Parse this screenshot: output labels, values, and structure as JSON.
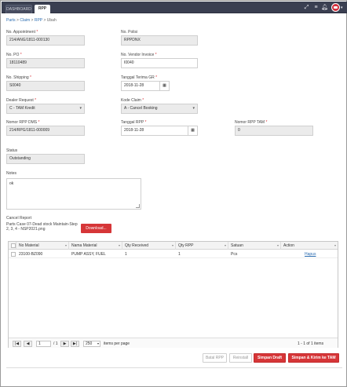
{
  "topbar": {
    "tabs": [
      "DASHBOARD",
      "RPP"
    ],
    "icons": [
      "expand-icon",
      "list-icon",
      "bell-icon",
      "user-avatar-icon"
    ]
  },
  "breadcrumb": {
    "items": [
      "Parts",
      "Claim",
      "RPP"
    ],
    "current": "Ubah"
  },
  "form": {
    "no_appointment": {
      "label": "No. Appointment",
      "value": "214/ANG/1811-000130"
    },
    "no_polisi": {
      "label": "No. Polisi",
      "value": "RPPDNX"
    },
    "no_po": {
      "label": "No. PO",
      "value": "18110489"
    },
    "no_vendor_invoice": {
      "label": "No. Vendor Invoice",
      "value": "I0040"
    },
    "no_shipping": {
      "label": "No. Shipping",
      "value": "S0040"
    },
    "tanggal_terima_gr": {
      "label": "Tanggal Terima GR",
      "value": "2018-11-28"
    },
    "dealer_request": {
      "label": "Dealer Request",
      "value": "C - TAM Kredit"
    },
    "kode_claim": {
      "label": "Kode Claim",
      "value": "A - Cancel Booking"
    },
    "nomor_rpp_dms": {
      "label": "Nomor RPP DMS",
      "value": "214/RPG/1811-000009"
    },
    "tanggal_rpp": {
      "label": "Tanggal RPP",
      "value": "2018-11-28"
    },
    "nomor_rpp_tam": {
      "label": "Nomor RPP TAM",
      "value": "0"
    },
    "status": {
      "label": "Status",
      "value": "Outstanding"
    },
    "notes": {
      "label": "Notes",
      "value": "ok"
    },
    "cancel_report": {
      "label": "Cancel Report",
      "filename": "Parts Case 07-Dead stock Maintain-Step 2, 3, 4 - NSP2021.png",
      "download_label": "Download..."
    }
  },
  "table": {
    "headers": [
      "No Material",
      "Nama Material",
      "Qty Received",
      "Qty RPP",
      "Satuan",
      "Action"
    ],
    "rows": [
      {
        "no_material": "23100-BZ090",
        "nama_material": "PUMP ASSY, FUEL",
        "qty_received": "1",
        "qty_rpp": "1",
        "satuan": "Pcs",
        "action": "Hapus"
      }
    ],
    "pager": {
      "page": "1",
      "of_pages": "/ 1",
      "page_size": "250",
      "items_per_page": "items per page",
      "summary": "1 - 1 of 1 items"
    }
  },
  "actions": {
    "batal": "Batal RPP",
    "reinstall": "Reinstall",
    "simpan_draft": "Simpan Draft",
    "simpan_kirim": "Simpan & Kirim ke TAM"
  },
  "colors": {
    "topbar": "#3a3f51",
    "primary_red": "#d63638",
    "link": "#2b6cb0"
  }
}
